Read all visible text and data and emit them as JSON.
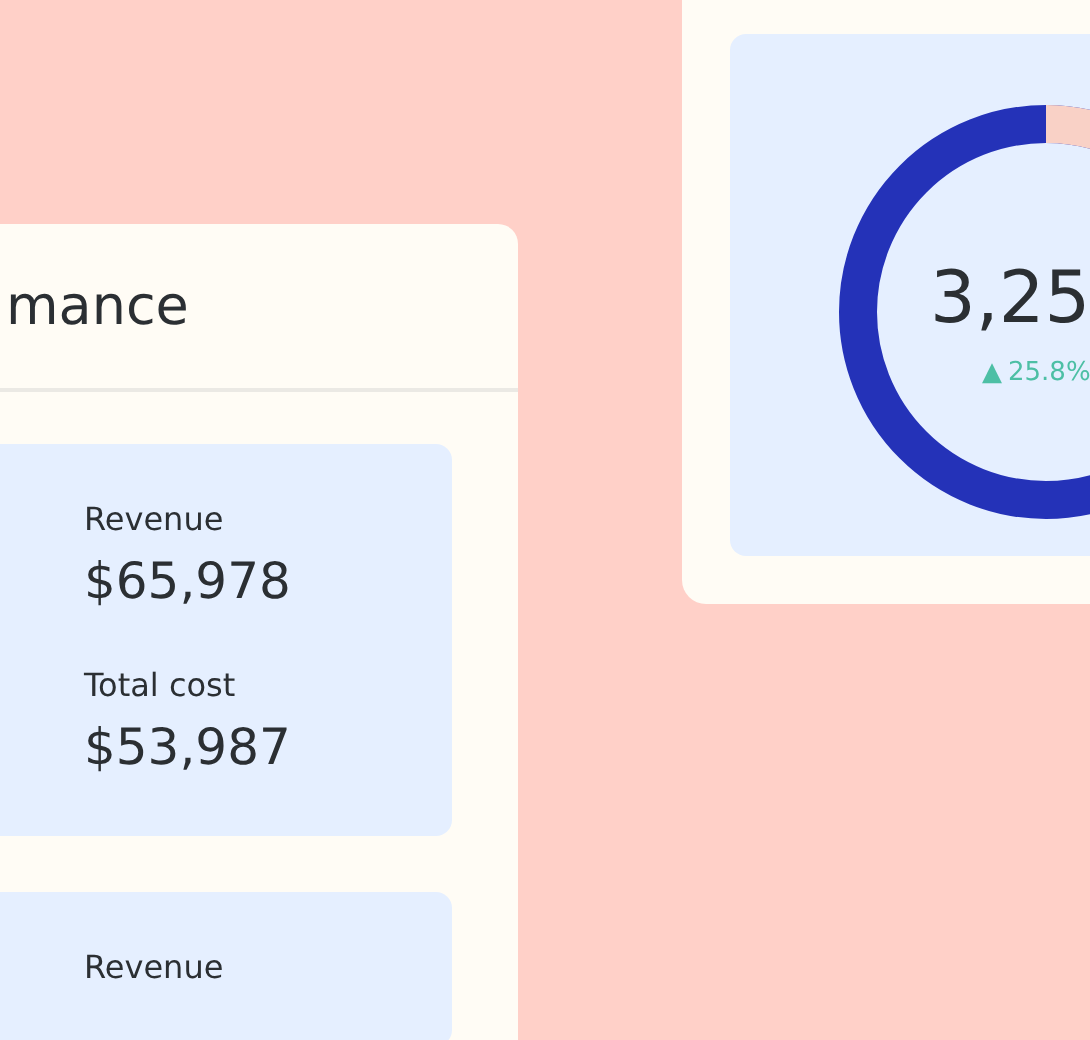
{
  "performance_card": {
    "title": "mance",
    "panels": [
      {
        "metrics": [
          {
            "label": "Revenue",
            "value": "$65,978"
          },
          {
            "label": "Total cost",
            "value": "$53,987"
          }
        ]
      },
      {
        "metrics": [
          {
            "label": "Revenue"
          }
        ]
      }
    ]
  },
  "donut_card": {
    "total": "3,25",
    "change": "25.8%",
    "trend_arrow": "▲"
  }
}
